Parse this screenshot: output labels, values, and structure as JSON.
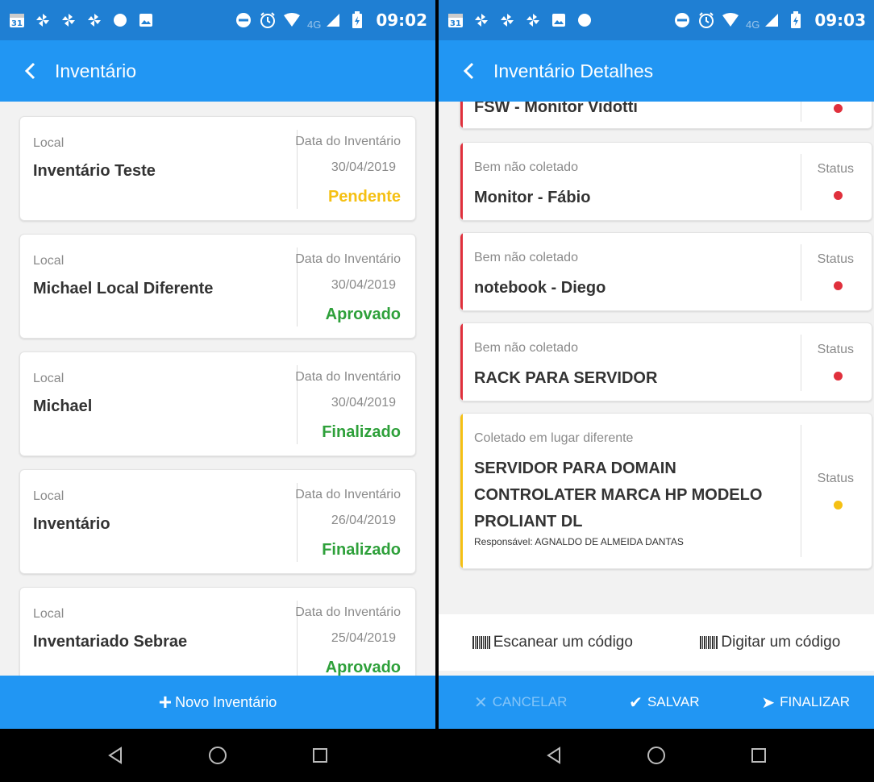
{
  "left": {
    "status_bar": {
      "time": "09:02",
      "network": "4G",
      "calendar_day": "31"
    },
    "appbar": {
      "title": "Inventário"
    },
    "cards": [
      {
        "label": "Local",
        "title": "Inventário Teste",
        "date_label": "Data do Inventário",
        "date": "30/04/2019",
        "status": "Pendente",
        "status_color": "#f5c013"
      },
      {
        "label": "Local",
        "title": "Michael Local Diferente",
        "date_label": "Data do Inventário",
        "date": "30/04/2019",
        "status": "Aprovado",
        "status_color": "#2ea03a"
      },
      {
        "label": "Local",
        "title": "Michael",
        "date_label": "Data do Inventário",
        "date": "30/04/2019",
        "status": "Finalizado",
        "status_color": "#2ea03a"
      },
      {
        "label": "Local",
        "title": "Inventário",
        "date_label": "Data do Inventário",
        "date": "26/04/2019",
        "status": "Finalizado",
        "status_color": "#2ea03a"
      },
      {
        "label": "Local",
        "title": "Inventariado Sebrae",
        "date_label": "Data do Inventário",
        "date": "25/04/2019",
        "status": "Aprovado",
        "status_color": "#2ea03a"
      }
    ],
    "new_button": {
      "label": "Novo Inventário"
    }
  },
  "right": {
    "status_bar": {
      "time": "09:03",
      "network": "4G",
      "calendar_day": "31"
    },
    "appbar": {
      "title": "Inventário Detalhes"
    },
    "partial_card": {
      "title": "FSW - Monitor Vidotti",
      "dot_color": "#e0303c"
    },
    "items": [
      {
        "label": "Bem não coletado",
        "title": "Monitor - Fábio",
        "status_label": "Status",
        "bar_color": "#e0303c",
        "dot_color": "#e0303c"
      },
      {
        "label": "Bem não coletado",
        "title": "notebook - Diego",
        "status_label": "Status",
        "bar_color": "#e0303c",
        "dot_color": "#e0303c"
      },
      {
        "label": "Bem não coletado",
        "title": "RACK PARA SERVIDOR",
        "status_label": "Status",
        "bar_color": "#e0303c",
        "dot_color": "#e0303c"
      },
      {
        "label": "Coletado em lugar diferente",
        "title": "SERVIDOR PARA DOMAIN CONTROLATER MARCA HP MODELO PROLIANT DL",
        "status_label": "Status",
        "bar_color": "#f5c013",
        "dot_color": "#f5c013",
        "responsible": "Responsável: AGNALDO DE ALMEIDA DANTAS"
      }
    ],
    "actions": {
      "scan": "Escanear um código",
      "type": "Digitar um código"
    },
    "footer": {
      "cancel": "CANCELAR",
      "save": "SALVAR",
      "finish": "FINALIZAR"
    }
  },
  "icons": {
    "back": "chevron-left-icon",
    "nav_back": "triangle-back-icon",
    "nav_home": "circle-home-icon",
    "nav_recent": "square-recent-icon"
  },
  "colors": {
    "status_bar": "#1f7fd3",
    "primary": "#2196f3",
    "text_dark": "#333333",
    "text_muted": "#8a8a8a"
  }
}
